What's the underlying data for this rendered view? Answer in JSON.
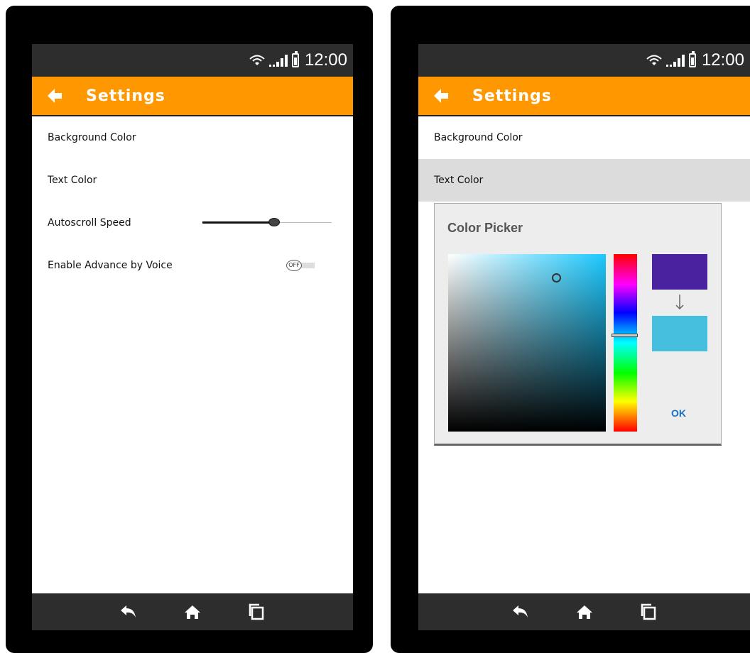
{
  "status_bar": {
    "time": "12:00"
  },
  "app_bar": {
    "title": "Settings"
  },
  "settings": {
    "items": [
      {
        "label": "Background Color"
      },
      {
        "label": "Text Color"
      },
      {
        "label": "Autoscroll Speed"
      },
      {
        "label": "Enable Advance by Voice"
      }
    ],
    "autoscroll_speed_fraction": 0.55,
    "voice_toggle_state": "OFF"
  },
  "color_picker": {
    "title": "Color Picker",
    "ok_label": "OK",
    "hue_color": "#1bc9ff",
    "old_color": "#4a22a0",
    "new_color": "#46bfdf"
  },
  "icons": [
    "wifi-icon",
    "signal-icon",
    "battery-icon",
    "back-arrow-icon",
    "nav-back-icon",
    "home-icon",
    "recents-icon"
  ],
  "colors": {
    "accent": "#ff9800",
    "status_bar": "#2d2d2d",
    "dialog_bg": "#ededed"
  }
}
